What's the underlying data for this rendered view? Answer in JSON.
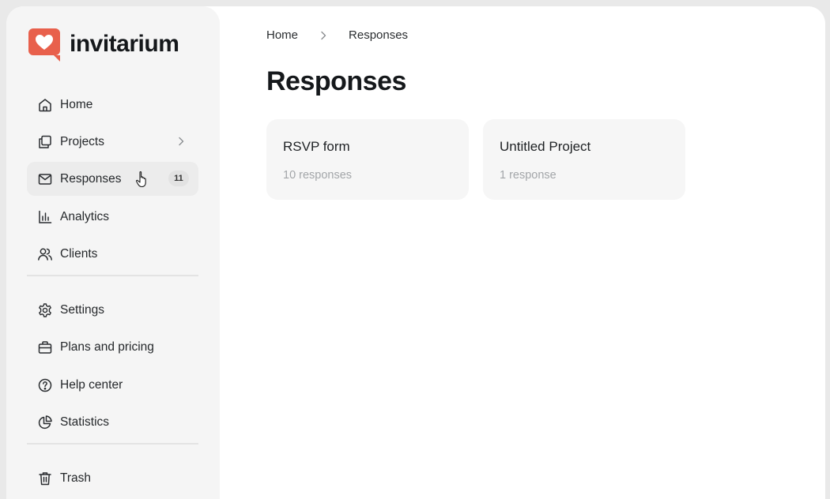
{
  "brand": {
    "name": "invitarium",
    "accent": "#e8604c"
  },
  "sidebar": {
    "items": [
      {
        "label": "Home",
        "icon": "home-icon"
      },
      {
        "label": "Projects",
        "icon": "projects-icon",
        "has_chevron": true
      },
      {
        "label": "Responses",
        "icon": "mail-icon",
        "badge": "11",
        "active": true
      },
      {
        "label": "Analytics",
        "icon": "bar-chart-icon"
      },
      {
        "label": "Clients",
        "icon": "users-icon"
      },
      {
        "label": "Settings",
        "icon": "gear-icon"
      },
      {
        "label": "Plans and pricing",
        "icon": "briefcase-icon"
      },
      {
        "label": "Help center",
        "icon": "help-icon"
      },
      {
        "label": "Statistics",
        "icon": "pie-chart-icon"
      },
      {
        "label": "Trash",
        "icon": "trash-icon"
      }
    ]
  },
  "breadcrumb": {
    "home": "Home",
    "current": "Responses"
  },
  "page": {
    "title": "Responses"
  },
  "cards": [
    {
      "title": "RSVP form",
      "subtitle": "10 responses"
    },
    {
      "title": "Untitled Project",
      "subtitle": "1 response"
    }
  ]
}
